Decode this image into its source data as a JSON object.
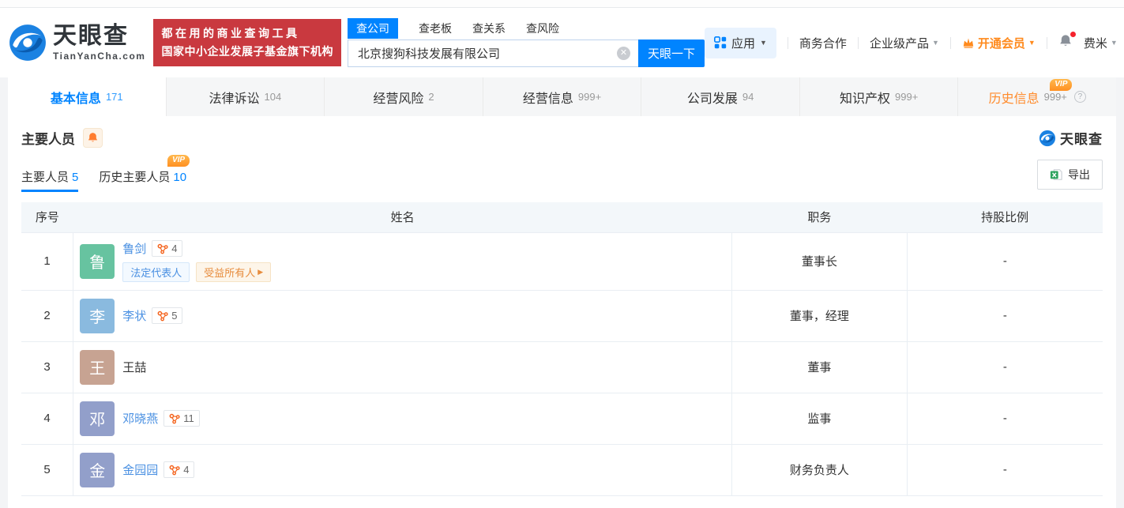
{
  "brand": {
    "name": "天眼查",
    "domain": "TianYanCha.com",
    "slogan_line1": "都在用的商业查询工具",
    "slogan_line2": "国家中小企业发展子基金旗下机构"
  },
  "search": {
    "tabs": [
      {
        "label": "查公司",
        "active": true
      },
      {
        "label": "查老板",
        "active": false
      },
      {
        "label": "查关系",
        "active": false
      },
      {
        "label": "查风险",
        "active": false
      }
    ],
    "value": "北京搜狗科技发展有限公司",
    "button_label": "天眼一下"
  },
  "nav": {
    "apps_label": "应用",
    "biz_label": "商务合作",
    "enterprise_label": "企业级产品",
    "vip_label": "开通会员",
    "user_label": "费米"
  },
  "badges": {
    "vip": "VIP"
  },
  "company_tabs": [
    {
      "label": "基本信息",
      "count": "171",
      "active": true
    },
    {
      "label": "法律诉讼",
      "count": "104",
      "active": false
    },
    {
      "label": "经营风险",
      "count": "2",
      "active": false
    },
    {
      "label": "经营信息",
      "count": "999+",
      "active": false
    },
    {
      "label": "公司发展",
      "count": "94",
      "active": false
    },
    {
      "label": "知识产权",
      "count": "999+",
      "active": false
    },
    {
      "label": "历史信息",
      "count": "999+",
      "active": false,
      "vip": true
    }
  ],
  "section": {
    "title": "主要人员",
    "watermark": "天眼查",
    "subtab1_label": "主要人员",
    "subtab1_count": "5",
    "subtab2_label": "历史主要人员",
    "subtab2_count": "10",
    "export_label": "导出"
  },
  "table": {
    "col_no": "序号",
    "col_name": "姓名",
    "col_position": "职务",
    "col_ratio": "持股比例",
    "rows": [
      {
        "no": "1",
        "avatar_char": "鲁",
        "avatar_style": "background:#67c3a0",
        "name": "鲁剑",
        "graph_count": "4",
        "tag1": "法定代表人",
        "tag2": "受益所有人",
        "position": "董事长",
        "ratio": "-"
      },
      {
        "no": "2",
        "avatar_char": "李",
        "avatar_style": "background:#8abadf",
        "name": "李状",
        "graph_count": "5",
        "position": "董事，经理",
        "ratio": "-"
      },
      {
        "no": "3",
        "avatar_char": "王",
        "avatar_style": "background:#c7a392",
        "name": "王喆",
        "position": "董事",
        "ratio": "-"
      },
      {
        "no": "4",
        "avatar_char": "邓",
        "avatar_style": "background:#929fca",
        "name": "邓晓燕",
        "graph_count": "11",
        "position": "监事",
        "ratio": "-"
      },
      {
        "no": "5",
        "avatar_char": "金",
        "avatar_style": "background:#929fca",
        "name": "金园园",
        "graph_count": "4",
        "position": "财务负责人",
        "ratio": "-"
      }
    ]
  },
  "colors": {
    "primary_blue": "#0084ff",
    "banner_red": "#c9393f",
    "accent_orange": "#ff8a1d",
    "link_blue": "#4a90e2",
    "graph_icon_orange": "#f4641e",
    "table_header_bg": "#f3f7fa"
  }
}
